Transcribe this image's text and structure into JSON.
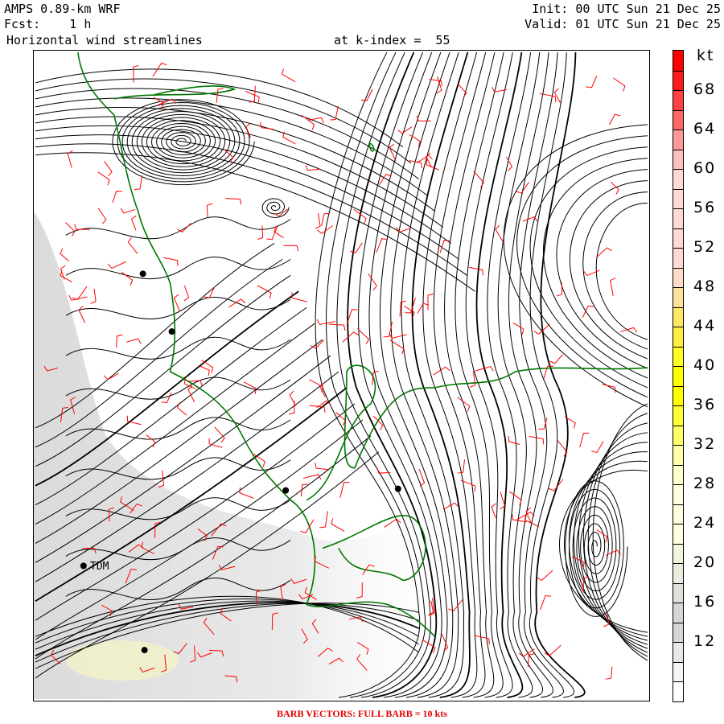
{
  "header": {
    "model": "AMPS 0.89-km WRF",
    "forecast": "Fcst:    1 h",
    "field": "Horizontal wind streamlines",
    "level": "at k-index =  55",
    "init": "Init: 00 UTC Sun 21 Dec 25",
    "valid": "Valid: 01 UTC Sun 21 Dec 25"
  },
  "colorbar": {
    "unit": "kt",
    "labels": [
      "68",
      "64",
      "60",
      "56",
      "52",
      "48",
      "44",
      "40",
      "36",
      "32",
      "28",
      "24",
      "20",
      "16",
      "12"
    ],
    "min": 8,
    "max": 72,
    "step": 2,
    "colors": [
      "#ff0000",
      "#ff1a1a",
      "#ff4040",
      "#ff6666",
      "#ff9999",
      "#ffc0c0",
      "#ffd8d8",
      "#ffd8d8",
      "#ffd8d8",
      "#ffd8d8",
      "#ffd8d8",
      "#ffdcc8",
      "#ffe099",
      "#ffe866",
      "#ffee44",
      "#ffff22",
      "#ffff00",
      "#ffff00",
      "#ffff33",
      "#ffff66",
      "#ffffaa",
      "#ffffcc",
      "#ffffdd",
      "#ffffdd",
      "#ffffdd",
      "#f5f5dc",
      "#ebebe0",
      "#e0e0dc",
      "#d6d6d6",
      "#d6d6d6",
      "#e8e8e8",
      "#f4f4f4",
      "#ffffff"
    ]
  },
  "stations": [
    {
      "label": "TDM"
    }
  ],
  "caption": "BARB VECTORS:  FULL BARB = 10 kts",
  "colors": {
    "streamline": "#000000",
    "barb": "#ff0000",
    "coastline": "#007700"
  }
}
